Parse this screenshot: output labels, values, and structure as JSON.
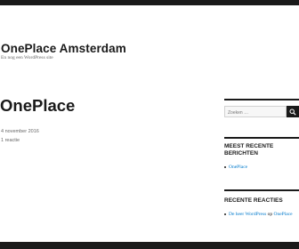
{
  "header": {
    "site_title": "OnePlace Amsterdam",
    "site_description": "En nog een WordPress site"
  },
  "post": {
    "title": "OnePlace",
    "date": "4 november 2016",
    "comments": "1 reactie"
  },
  "sidebar": {
    "search_placeholder": "Zoeken …",
    "recent_posts_title": "Meest recente berichten",
    "recent_posts": [
      "OnePlace"
    ],
    "recent_comments_title": "Recente reacties",
    "recent_comment": {
      "author": "De heer WordPress",
      "connector": " op ",
      "post": "OnePlace"
    }
  },
  "colors": {
    "text": "#1a1a1a",
    "muted": "#686868",
    "link": "#007acc"
  },
  "icons": {
    "search": "magnifier-icon"
  }
}
